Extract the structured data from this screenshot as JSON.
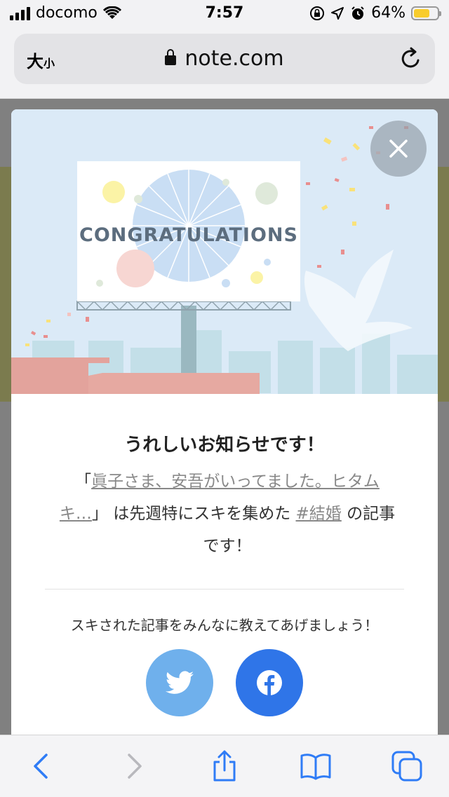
{
  "status_bar": {
    "carrier": "docomo",
    "time": "7:57",
    "battery": "64%"
  },
  "url_bar": {
    "text_size_large": "大",
    "text_size_small": "小",
    "host": "note.com"
  },
  "modal": {
    "billboard_text": "CONGRATULATIONS",
    "title": "うれしいお知らせです！",
    "message": {
      "open_quote": "「",
      "article_link": "眞子さま、安吾がいってました。ヒタムキ…",
      "close_quote": "」",
      "middle_text": "は先週特にスキを集めた",
      "hashtag": "#結婚",
      "end_text": "の記事です！"
    },
    "share_prompt": "スキされた記事をみんなに教えてあげましょう！"
  },
  "colors": {
    "twitter": "#6fb0ec",
    "facebook": "#2f75e8",
    "ios_blue": "#2f7cf6",
    "sky": "#dbeaf7"
  },
  "icons": {
    "close": "close-icon",
    "twitter": "twitter-icon",
    "facebook": "facebook-icon",
    "back": "chevron-left-icon",
    "forward": "chevron-right-icon",
    "share": "share-icon",
    "bookmarks": "book-icon",
    "tabs": "tabs-icon"
  }
}
